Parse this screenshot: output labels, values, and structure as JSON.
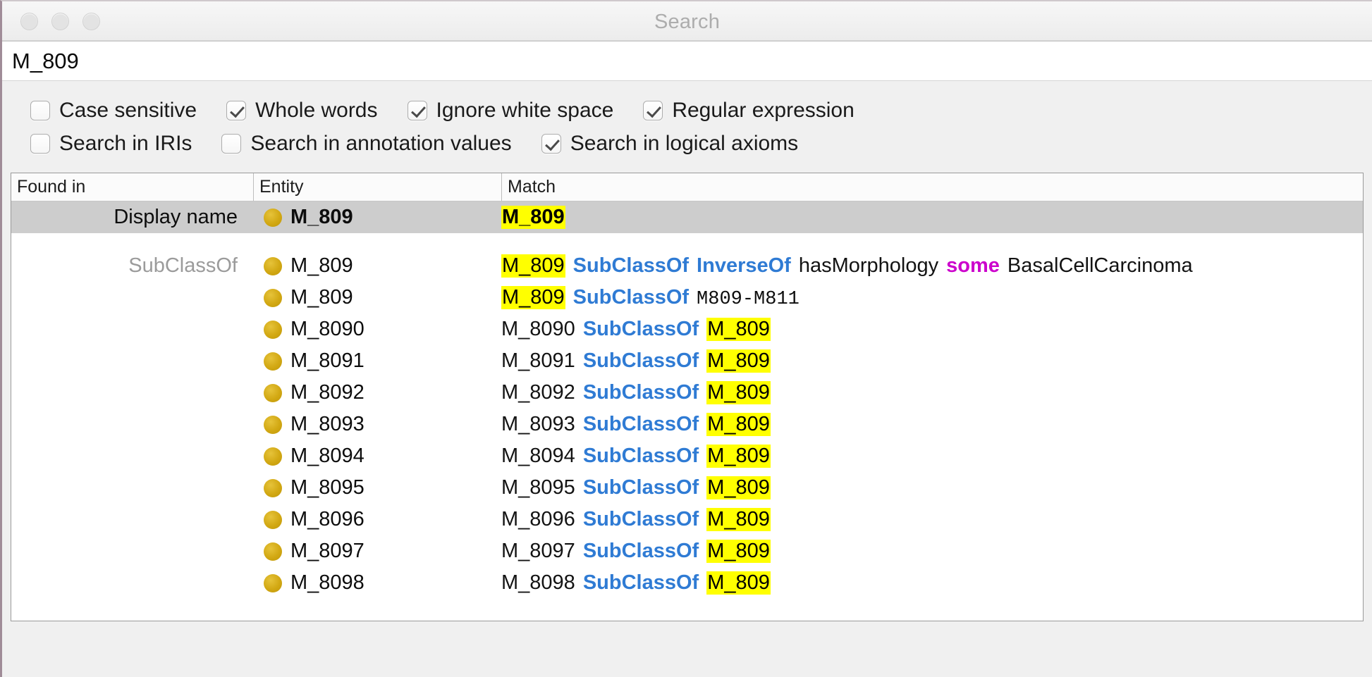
{
  "window": {
    "title": "Search",
    "traffic_lights": [
      "close",
      "minimize",
      "zoom"
    ]
  },
  "search": {
    "value": "M_809",
    "placeholder": ""
  },
  "options": {
    "row1": [
      {
        "label": "Case sensitive",
        "checked": false
      },
      {
        "label": "Whole words",
        "checked": true
      },
      {
        "label": "Ignore white space",
        "checked": true
      },
      {
        "label": "Regular expression",
        "checked": true
      }
    ],
    "row2": [
      {
        "label": "Search in IRIs",
        "checked": false
      },
      {
        "label": "Search in annotation values",
        "checked": false
      },
      {
        "label": "Search in logical axioms",
        "checked": true
      }
    ]
  },
  "table": {
    "columns": [
      "Found in",
      "Entity",
      "Match"
    ],
    "rows": [
      {
        "found_in": "Display name",
        "entity": "M_809",
        "entity_bold": true,
        "selected": true,
        "match_parts": [
          {
            "text": "M_809",
            "style": "highlight-bold"
          }
        ]
      },
      {
        "found_in": "SubClassOf",
        "entity": "M_809",
        "entity_bold": false,
        "selected": false,
        "match_parts": [
          {
            "text": "M_809",
            "style": "highlight"
          },
          {
            "text": "SubClassOf",
            "style": "blue"
          },
          {
            "text": "InverseOf",
            "style": "blue"
          },
          {
            "text": "hasMorphology",
            "style": "plain"
          },
          {
            "text": "some",
            "style": "magenta"
          },
          {
            "text": "BasalCellCarcinoma",
            "style": "plain"
          }
        ]
      },
      {
        "found_in": "",
        "entity": "M_809",
        "entity_bold": false,
        "selected": false,
        "match_parts": [
          {
            "text": "M_809",
            "style": "highlight"
          },
          {
            "text": "SubClassOf",
            "style": "blue"
          },
          {
            "text": "M809-M811",
            "style": "mono"
          }
        ]
      },
      {
        "found_in": "",
        "entity": "M_8090",
        "entity_bold": false,
        "selected": false,
        "match_parts": [
          {
            "text": "M_8090",
            "style": "plain"
          },
          {
            "text": "SubClassOf",
            "style": "blue"
          },
          {
            "text": "M_809",
            "style": "highlight"
          }
        ]
      },
      {
        "found_in": "",
        "entity": "M_8091",
        "entity_bold": false,
        "selected": false,
        "match_parts": [
          {
            "text": "M_8091",
            "style": "plain"
          },
          {
            "text": "SubClassOf",
            "style": "blue"
          },
          {
            "text": "M_809",
            "style": "highlight"
          }
        ]
      },
      {
        "found_in": "",
        "entity": "M_8092",
        "entity_bold": false,
        "selected": false,
        "match_parts": [
          {
            "text": "M_8092",
            "style": "plain"
          },
          {
            "text": "SubClassOf",
            "style": "blue"
          },
          {
            "text": "M_809",
            "style": "highlight"
          }
        ]
      },
      {
        "found_in": "",
        "entity": "M_8093",
        "entity_bold": false,
        "selected": false,
        "match_parts": [
          {
            "text": "M_8093",
            "style": "plain"
          },
          {
            "text": "SubClassOf",
            "style": "blue"
          },
          {
            "text": "M_809",
            "style": "highlight"
          }
        ]
      },
      {
        "found_in": "",
        "entity": "M_8094",
        "entity_bold": false,
        "selected": false,
        "match_parts": [
          {
            "text": "M_8094",
            "style": "plain"
          },
          {
            "text": "SubClassOf",
            "style": "blue"
          },
          {
            "text": "M_809",
            "style": "highlight"
          }
        ]
      },
      {
        "found_in": "",
        "entity": "M_8095",
        "entity_bold": false,
        "selected": false,
        "match_parts": [
          {
            "text": "M_8095",
            "style": "plain"
          },
          {
            "text": "SubClassOf",
            "style": "blue"
          },
          {
            "text": "M_809",
            "style": "highlight"
          }
        ]
      },
      {
        "found_in": "",
        "entity": "M_8096",
        "entity_bold": false,
        "selected": false,
        "match_parts": [
          {
            "text": "M_8096",
            "style": "plain"
          },
          {
            "text": "SubClassOf",
            "style": "blue"
          },
          {
            "text": "M_809",
            "style": "highlight"
          }
        ]
      },
      {
        "found_in": "",
        "entity": "M_8097",
        "entity_bold": false,
        "selected": false,
        "match_parts": [
          {
            "text": "M_8097",
            "style": "plain"
          },
          {
            "text": "SubClassOf",
            "style": "blue"
          },
          {
            "text": "M_809",
            "style": "highlight"
          }
        ]
      },
      {
        "found_in": "",
        "entity": "M_8098",
        "entity_bold": false,
        "selected": false,
        "match_parts": [
          {
            "text": "M_8098",
            "style": "plain"
          },
          {
            "text": "SubClassOf",
            "style": "blue"
          },
          {
            "text": "M_809",
            "style": "highlight"
          }
        ]
      }
    ]
  },
  "colors": {
    "highlight": "#ffff00",
    "keyword_blue": "#2f7bd4",
    "keyword_magenta": "#cc00cc",
    "entity_dot": "#d2a813",
    "selected_row": "#cdcdcd",
    "title_text": "#adadad"
  }
}
